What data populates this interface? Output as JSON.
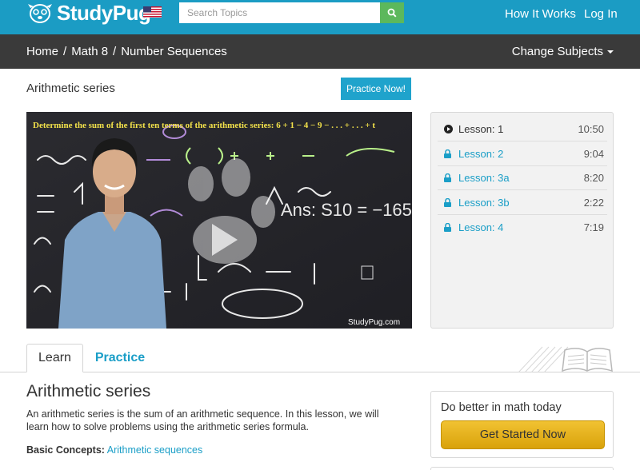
{
  "header": {
    "brand": "StudyPug",
    "search_placeholder": "Search Topics",
    "nav": [
      "How It Works",
      "Log In"
    ]
  },
  "breadcrumb": {
    "items": [
      "Home",
      "Math 8",
      "Number Sequences"
    ],
    "separator": "/",
    "change_subjects": "Change Subjects"
  },
  "lesson": {
    "title": "Arithmetic series",
    "practice_button": "Practice Now!",
    "video_heading": "Determine the sum of the first ten terms of the arithmetic series: 6 + 1 − 4 − 9 − . . . + . . . + t",
    "video_answer": "Ans: S10 = −165",
    "video_watermark": "StudyPug.com"
  },
  "playlist": [
    {
      "label": "Lesson: 1",
      "time": "10:50",
      "state": "playing"
    },
    {
      "label": "Lesson: 2",
      "time": "9:04",
      "state": "locked"
    },
    {
      "label": "Lesson: 3a",
      "time": "8:20",
      "state": "locked"
    },
    {
      "label": "Lesson: 3b",
      "time": "2:22",
      "state": "locked"
    },
    {
      "label": "Lesson: 4",
      "time": "7:19",
      "state": "locked"
    }
  ],
  "tabs": [
    {
      "label": "Learn",
      "active": true
    },
    {
      "label": "Practice",
      "active": false
    }
  ],
  "content": {
    "title": "Arithmetic series",
    "description": "An arithmetic series is the sum of an arithmetic sequence. In this lesson, we will learn how to solve problems using the arithmetic series formula.",
    "basic_concepts_label": "Basic Concepts:",
    "basic_concepts_link": "Arithmetic sequences"
  },
  "cta": {
    "title": "Do better in math today",
    "button": "Get Started Now"
  },
  "colors": {
    "topbar": "#1b9cc4",
    "crumbbar": "#3a3a3a",
    "accent_link": "#1a9ec7",
    "search_button": "#5cb85c",
    "cta_gold": "#e8b422"
  },
  "icons": {
    "search": "magnifier-icon",
    "play": "play-circle-icon",
    "lock": "lock-icon",
    "caret": "caret-down-icon"
  }
}
